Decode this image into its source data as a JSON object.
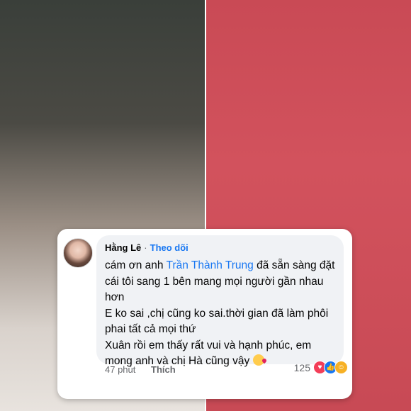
{
  "comment": {
    "author": "Hằng Lê",
    "separator": "·",
    "follow_label": "Theo dõi",
    "lines": {
      "l1_prefix": "cám ơn anh ",
      "mention": "Trần Thành Trung",
      "l1_suffix": " đã sẵn sàng đặt",
      "l2": "cái tôi sang 1 bên mang mọi người gần nhau",
      "l3": "hơn",
      "l4": "E ko sai ,chị cũng ko sai.thời gian đã làm phôi",
      "l5": "phai tất cả mọi thứ",
      "l6": "Xuân rồi em thấy rất vui và hạnh phúc, em",
      "l7": "mong anh và chị Hà cũng vậy"
    },
    "timestamp": "47 phút",
    "like_label": "Thích",
    "reaction_count": "125",
    "reactions": [
      "love-icon",
      "like-icon",
      "care-icon"
    ],
    "colors": {
      "link": "#1877f2",
      "bubble": "#f0f2f5"
    }
  }
}
